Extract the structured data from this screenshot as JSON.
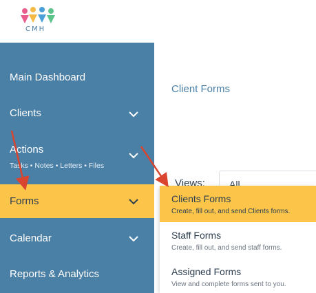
{
  "logo": {
    "text": "CMH"
  },
  "sidebar": {
    "items": [
      {
        "label": "Main Dashboard"
      },
      {
        "label": "Clients"
      },
      {
        "label": "Actions",
        "sub": "Tasks • Notes • Letters • Files"
      },
      {
        "label": "Forms"
      },
      {
        "label": "Calendar"
      },
      {
        "label": "Reports & Analytics"
      }
    ]
  },
  "main": {
    "title": "Client Forms",
    "views_label": "Views:",
    "views_value": "All"
  },
  "dropdown": {
    "items": [
      {
        "title": "Clients Forms",
        "desc": "Create, fill out, and send Clients forms."
      },
      {
        "title": "Staff Forms",
        "desc": "Create, fill out, and send staff forms."
      },
      {
        "title": "Assigned Forms",
        "desc": "View and complete forms sent to you."
      }
    ]
  },
  "colors": {
    "sidebar_bg": "#4a7fa6",
    "highlight": "#fcc54a",
    "arrow": "#d9452e"
  }
}
